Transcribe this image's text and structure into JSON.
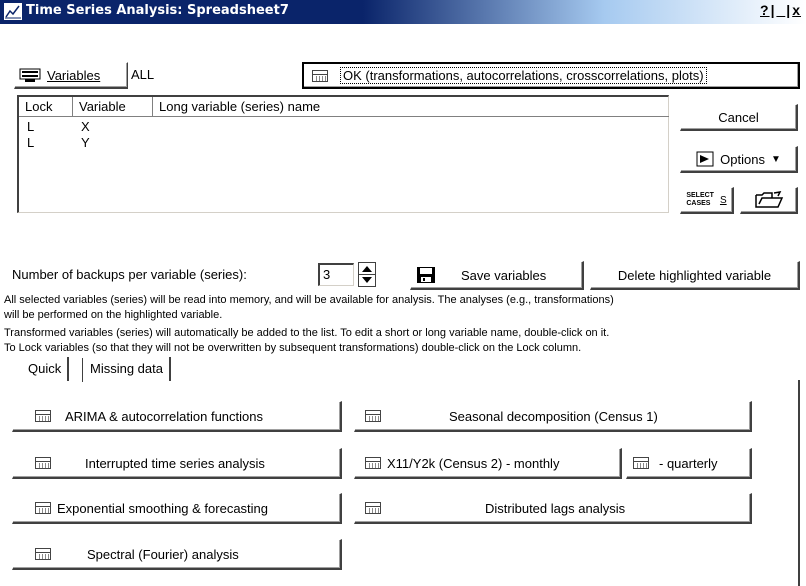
{
  "window": {
    "title": "Time Series Analysis: Spreadsheet7",
    "help": "?",
    "minimize": "_",
    "close": "x"
  },
  "variables": {
    "button_label": "Variables",
    "value": "ALL"
  },
  "ok_button": "OK (transformations, autocorrelations, crosscorrelations, plots)",
  "cancel_button": "Cancel",
  "options_button": "Options",
  "select_cases": {
    "line1": "SELECT",
    "line2": "CASES",
    "symbol": "S"
  },
  "table": {
    "headers": [
      "Lock",
      "Variable",
      "Long variable (series) name"
    ],
    "rows": [
      {
        "lock": "L",
        "variable": "X",
        "long_name": ""
      },
      {
        "lock": "L",
        "variable": "Y",
        "long_name": ""
      }
    ]
  },
  "backups": {
    "label": "Number of backups per variable (series):",
    "value": "3"
  },
  "save_variables": "Save variables",
  "delete_highlighted": "Delete highlighted variable",
  "info": {
    "line1": "All selected variables (series) will be read into memory, and will be available for analysis. The analyses (e.g., transformations)",
    "line2": "will be performed on the highlighted variable.",
    "line3": "Transformed variables (series) will automatically be added to the list. To edit a short or long variable name, double-click on it.",
    "line4": "To Lock variables (so that they will not be overwritten by subsequent transformations) double-click on the Lock column."
  },
  "tabs": [
    "Quick",
    "Missing data"
  ],
  "buttons": {
    "arima": "ARIMA & autocorrelation functions",
    "interrupted": "Interrupted time series analysis",
    "exponential": "Exponential smoothing & forecasting",
    "spectral": "Spectral (Fourier) analysis",
    "seasonal": "Seasonal decomposition (Census 1)",
    "x11": "X11/Y2k (Census 2) - monthly",
    "quarterly": "- quarterly",
    "distributed": "Distributed lags analysis"
  }
}
